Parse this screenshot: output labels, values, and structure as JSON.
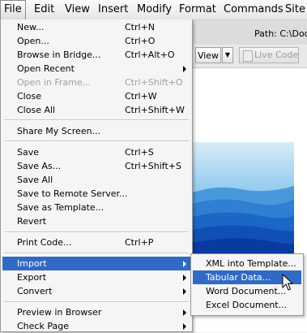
{
  "menubar": {
    "items": [
      {
        "label": "File",
        "active": true
      },
      {
        "label": "Edit"
      },
      {
        "label": "View"
      },
      {
        "label": "Insert"
      },
      {
        "label": "Modify"
      },
      {
        "label": "Format"
      },
      {
        "label": "Commands"
      },
      {
        "label": "Site"
      }
    ]
  },
  "background": {
    "path_label": "Path:",
    "path_value": "C:\\Doc",
    "view_button": "View",
    "live_code_button": "Live Code"
  },
  "file_menu": {
    "items": [
      {
        "label": "New...",
        "shortcut": "Ctrl+N"
      },
      {
        "label": "Open...",
        "shortcut": "Ctrl+O"
      },
      {
        "label": "Browse in Bridge...",
        "shortcut": "Ctrl+Alt+O"
      },
      {
        "label": "Open Recent",
        "submenu": true
      },
      {
        "label": "Open in Frame...",
        "shortcut": "Ctrl+Shift+O",
        "disabled": true
      },
      {
        "label": "Close",
        "shortcut": "Ctrl+W"
      },
      {
        "label": "Close All",
        "shortcut": "Ctrl+Shift+W"
      },
      {
        "label": "Share My Screen..."
      },
      {
        "label": "Save",
        "shortcut": "Ctrl+S"
      },
      {
        "label": "Save As...",
        "shortcut": "Ctrl+Shift+S"
      },
      {
        "label": "Save All"
      },
      {
        "label": "Save to Remote Server..."
      },
      {
        "label": "Save as Template..."
      },
      {
        "label": "Revert"
      },
      {
        "label": "Print Code...",
        "shortcut": "Ctrl+P"
      },
      {
        "label": "Import",
        "submenu": true,
        "highlighted": true
      },
      {
        "label": "Export",
        "submenu": true
      },
      {
        "label": "Convert",
        "submenu": true
      },
      {
        "label": "Preview in Browser",
        "submenu": true
      },
      {
        "label": "Check Page",
        "submenu": true
      }
    ]
  },
  "import_submenu": {
    "items": [
      {
        "label": "XML into Template..."
      },
      {
        "label": "Tabular Data...",
        "highlighted": true
      },
      {
        "label": "Word Document..."
      },
      {
        "label": "Excel Document..."
      }
    ]
  },
  "colors": {
    "highlight": "#316ac5",
    "menu_bg": "#f5f5f5",
    "disabled_text": "#a0a0a0"
  },
  "icons": [
    "submenu-arrow-icon",
    "view-dropdown-icon",
    "live-code-icon",
    "mouse-pointer-icon"
  ]
}
